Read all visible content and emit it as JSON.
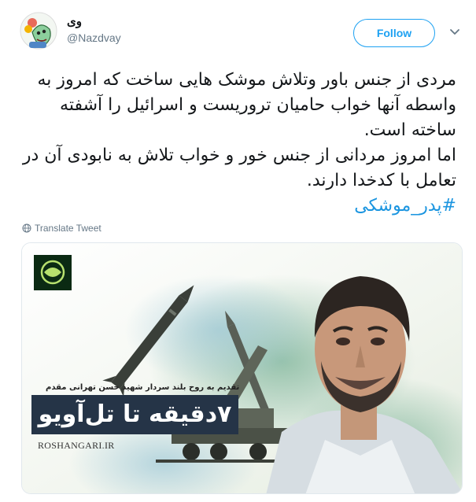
{
  "user": {
    "display_name": "وی",
    "handle": "@Nazdvay",
    "avatar_icon": "cartoon-avatar-icon"
  },
  "follow_label": "Follow",
  "tweet": {
    "para1": "مردی از جنس باور وتلاش موشک هایی ساخت که امروز به واسطه آنها خواب حامیان تروریست و اسرائیل را آشفته ساخته است.",
    "para2": "اما امروز مردانی از جنس خور و خواب تلاش به نابودی آن در تعامل با کدخدا دارند.",
    "hashtag": "#پدر_موشکی"
  },
  "translate_label": "Translate Tweet",
  "media": {
    "headline": "۷دقیقه تا تل‌آویو",
    "subtitle": "تقدیم به روح بلند سردار شهید حسن تهرانی مقدم",
    "site": "ROSHANGARI.IR"
  },
  "colors": {
    "accent": "#1da1f2",
    "hashtag": "#1b95e0",
    "muted": "#657786",
    "banner": "#253447"
  }
}
